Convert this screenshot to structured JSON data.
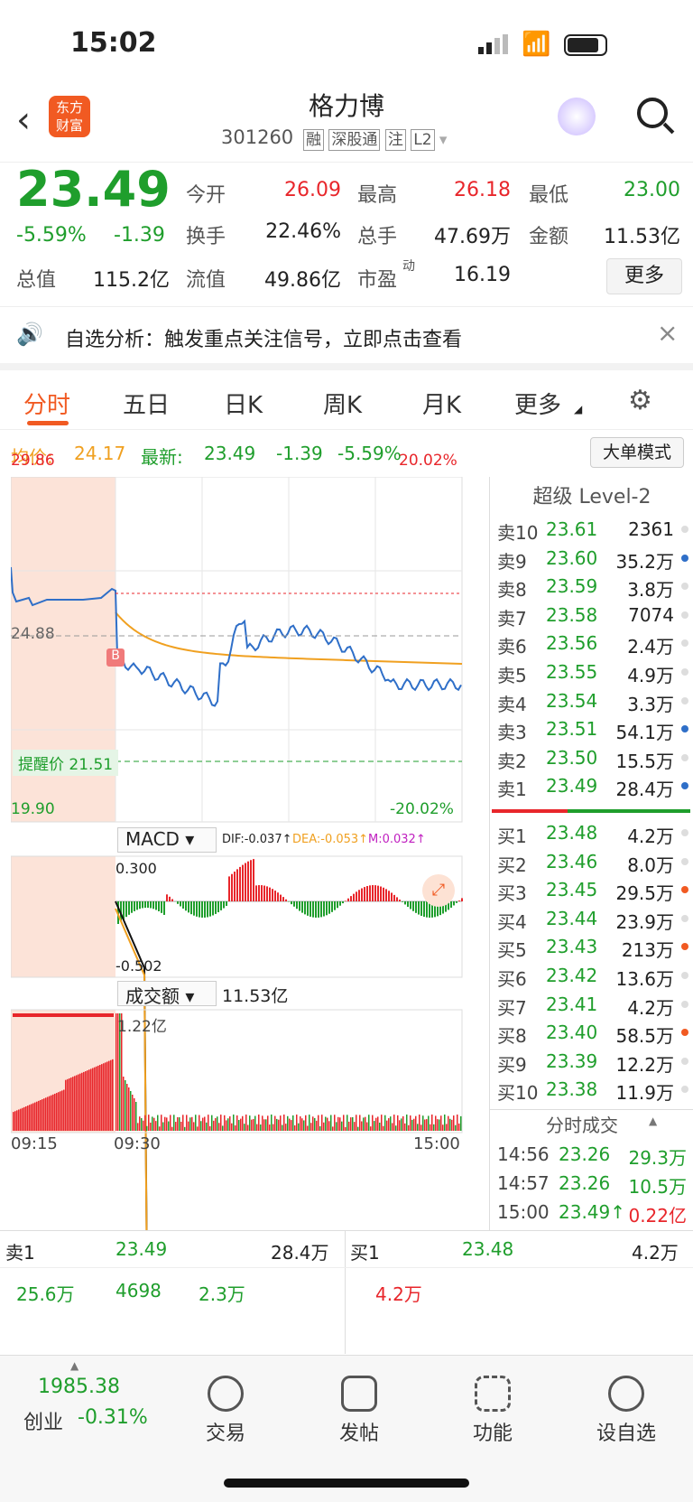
{
  "status": {
    "time": "15:02"
  },
  "header": {
    "brand": "东方\n财富",
    "stock_name": "格力博",
    "code": "301260",
    "tags": [
      "融",
      "深股通",
      "注",
      "L2"
    ]
  },
  "quote": {
    "price": "23.49",
    "pct": "-5.59%",
    "chg": "-1.39",
    "row1": [
      {
        "k": "今开",
        "v": "26.09"
      },
      {
        "k": "最高",
        "v": "26.18"
      },
      {
        "k": "最低",
        "v": "23.00"
      }
    ],
    "row2": [
      {
        "k": "换手",
        "v": "22.46%"
      },
      {
        "k": "总手",
        "v": "47.69万"
      },
      {
        "k": "金额",
        "v": "11.53亿"
      }
    ],
    "row3": [
      {
        "k": "总值",
        "v": "115.2亿"
      },
      {
        "k": "流值",
        "v": "49.86亿"
      },
      {
        "k": "市盈",
        "sup": "动",
        "v": "16.19"
      }
    ],
    "more_btn": "更多"
  },
  "banner": {
    "text": "自选分析：触发重点关注信号，立即点击查看",
    "close": "×"
  },
  "tabs": [
    "分时",
    "五日",
    "日K",
    "周K",
    "月K",
    "更多"
  ],
  "info": {
    "avg_label": "均价:",
    "avg": "24.17",
    "last_label": "最新:",
    "last": "23.49",
    "chg": "-1.39",
    "pct": "-5.59%",
    "mode_btn": "大单模式"
  },
  "chart": {
    "y_top": "29.86",
    "y_mid": "24.88",
    "y_bot": "19.90",
    "pct_top": "20.02%",
    "pct_bot": "-20.02%",
    "alert": "提醒价 21.51",
    "b_marker": "B",
    "macd_label": "MACD",
    "dif": "DIF:-0.037↑",
    "dea": "DEA:-0.053↑",
    "m": "M:0.032↑",
    "macd_top": "0.300",
    "macd_bot": "-0.502",
    "vol_label": "成交额",
    "vol_val": "11.53亿",
    "vol_top": "1.22亿",
    "t0": "09:15",
    "t1": "09:30",
    "t2": "15:00"
  },
  "colors": {
    "up": "#e8262b",
    "down": "#1f9e2c",
    "avg": "#f0a020",
    "line": "#2f6fc8",
    "brand": "#f15a22"
  },
  "book": {
    "title": "超级 Level-2",
    "asks": [
      [
        "卖10",
        "23.61",
        "2361"
      ],
      [
        "卖9",
        "23.60",
        "35.2万"
      ],
      [
        "卖8",
        "23.59",
        "3.8万"
      ],
      [
        "卖7",
        "23.58",
        "7074"
      ],
      [
        "卖6",
        "23.56",
        "2.4万"
      ],
      [
        "卖5",
        "23.55",
        "4.9万"
      ],
      [
        "卖4",
        "23.54",
        "3.3万"
      ],
      [
        "卖3",
        "23.51",
        "54.1万"
      ],
      [
        "卖2",
        "23.50",
        "15.5万"
      ],
      [
        "卖1",
        "23.49",
        "28.4万"
      ]
    ],
    "bids": [
      [
        "买1",
        "23.48",
        "4.2万"
      ],
      [
        "买2",
        "23.46",
        "8.0万"
      ],
      [
        "买3",
        "23.45",
        "29.5万"
      ],
      [
        "买4",
        "23.44",
        "23.9万"
      ],
      [
        "买5",
        "23.43",
        "213万"
      ],
      [
        "买6",
        "23.42",
        "13.6万"
      ],
      [
        "买7",
        "23.41",
        "4.2万"
      ],
      [
        "买8",
        "23.40",
        "58.5万"
      ],
      [
        "买9",
        "23.39",
        "12.2万"
      ],
      [
        "买10",
        "23.38",
        "11.9万"
      ]
    ],
    "ticks_title": "分时成交",
    "ticks": [
      [
        "14:56",
        "23.26",
        "29.3万"
      ],
      [
        "14:57",
        "23.26",
        "10.5万"
      ],
      [
        "15:00",
        "23.49↑",
        "0.22亿"
      ]
    ]
  },
  "lower": {
    "ask_label": "卖1",
    "ask_price": "23.49",
    "ask_vol": "28.4万",
    "bid_label": "买1",
    "bid_price": "23.48",
    "bid_vol": "4.2万",
    "ask_queue": [
      "25.6万",
      "4698",
      "2.3万"
    ],
    "bid_queue": [
      "4.2万"
    ]
  },
  "bottom": {
    "index_val": "1985.38",
    "index_name": "创业",
    "index_pct": "-0.31%",
    "items": [
      "交易",
      "发帖",
      "功能",
      "设自选"
    ]
  }
}
